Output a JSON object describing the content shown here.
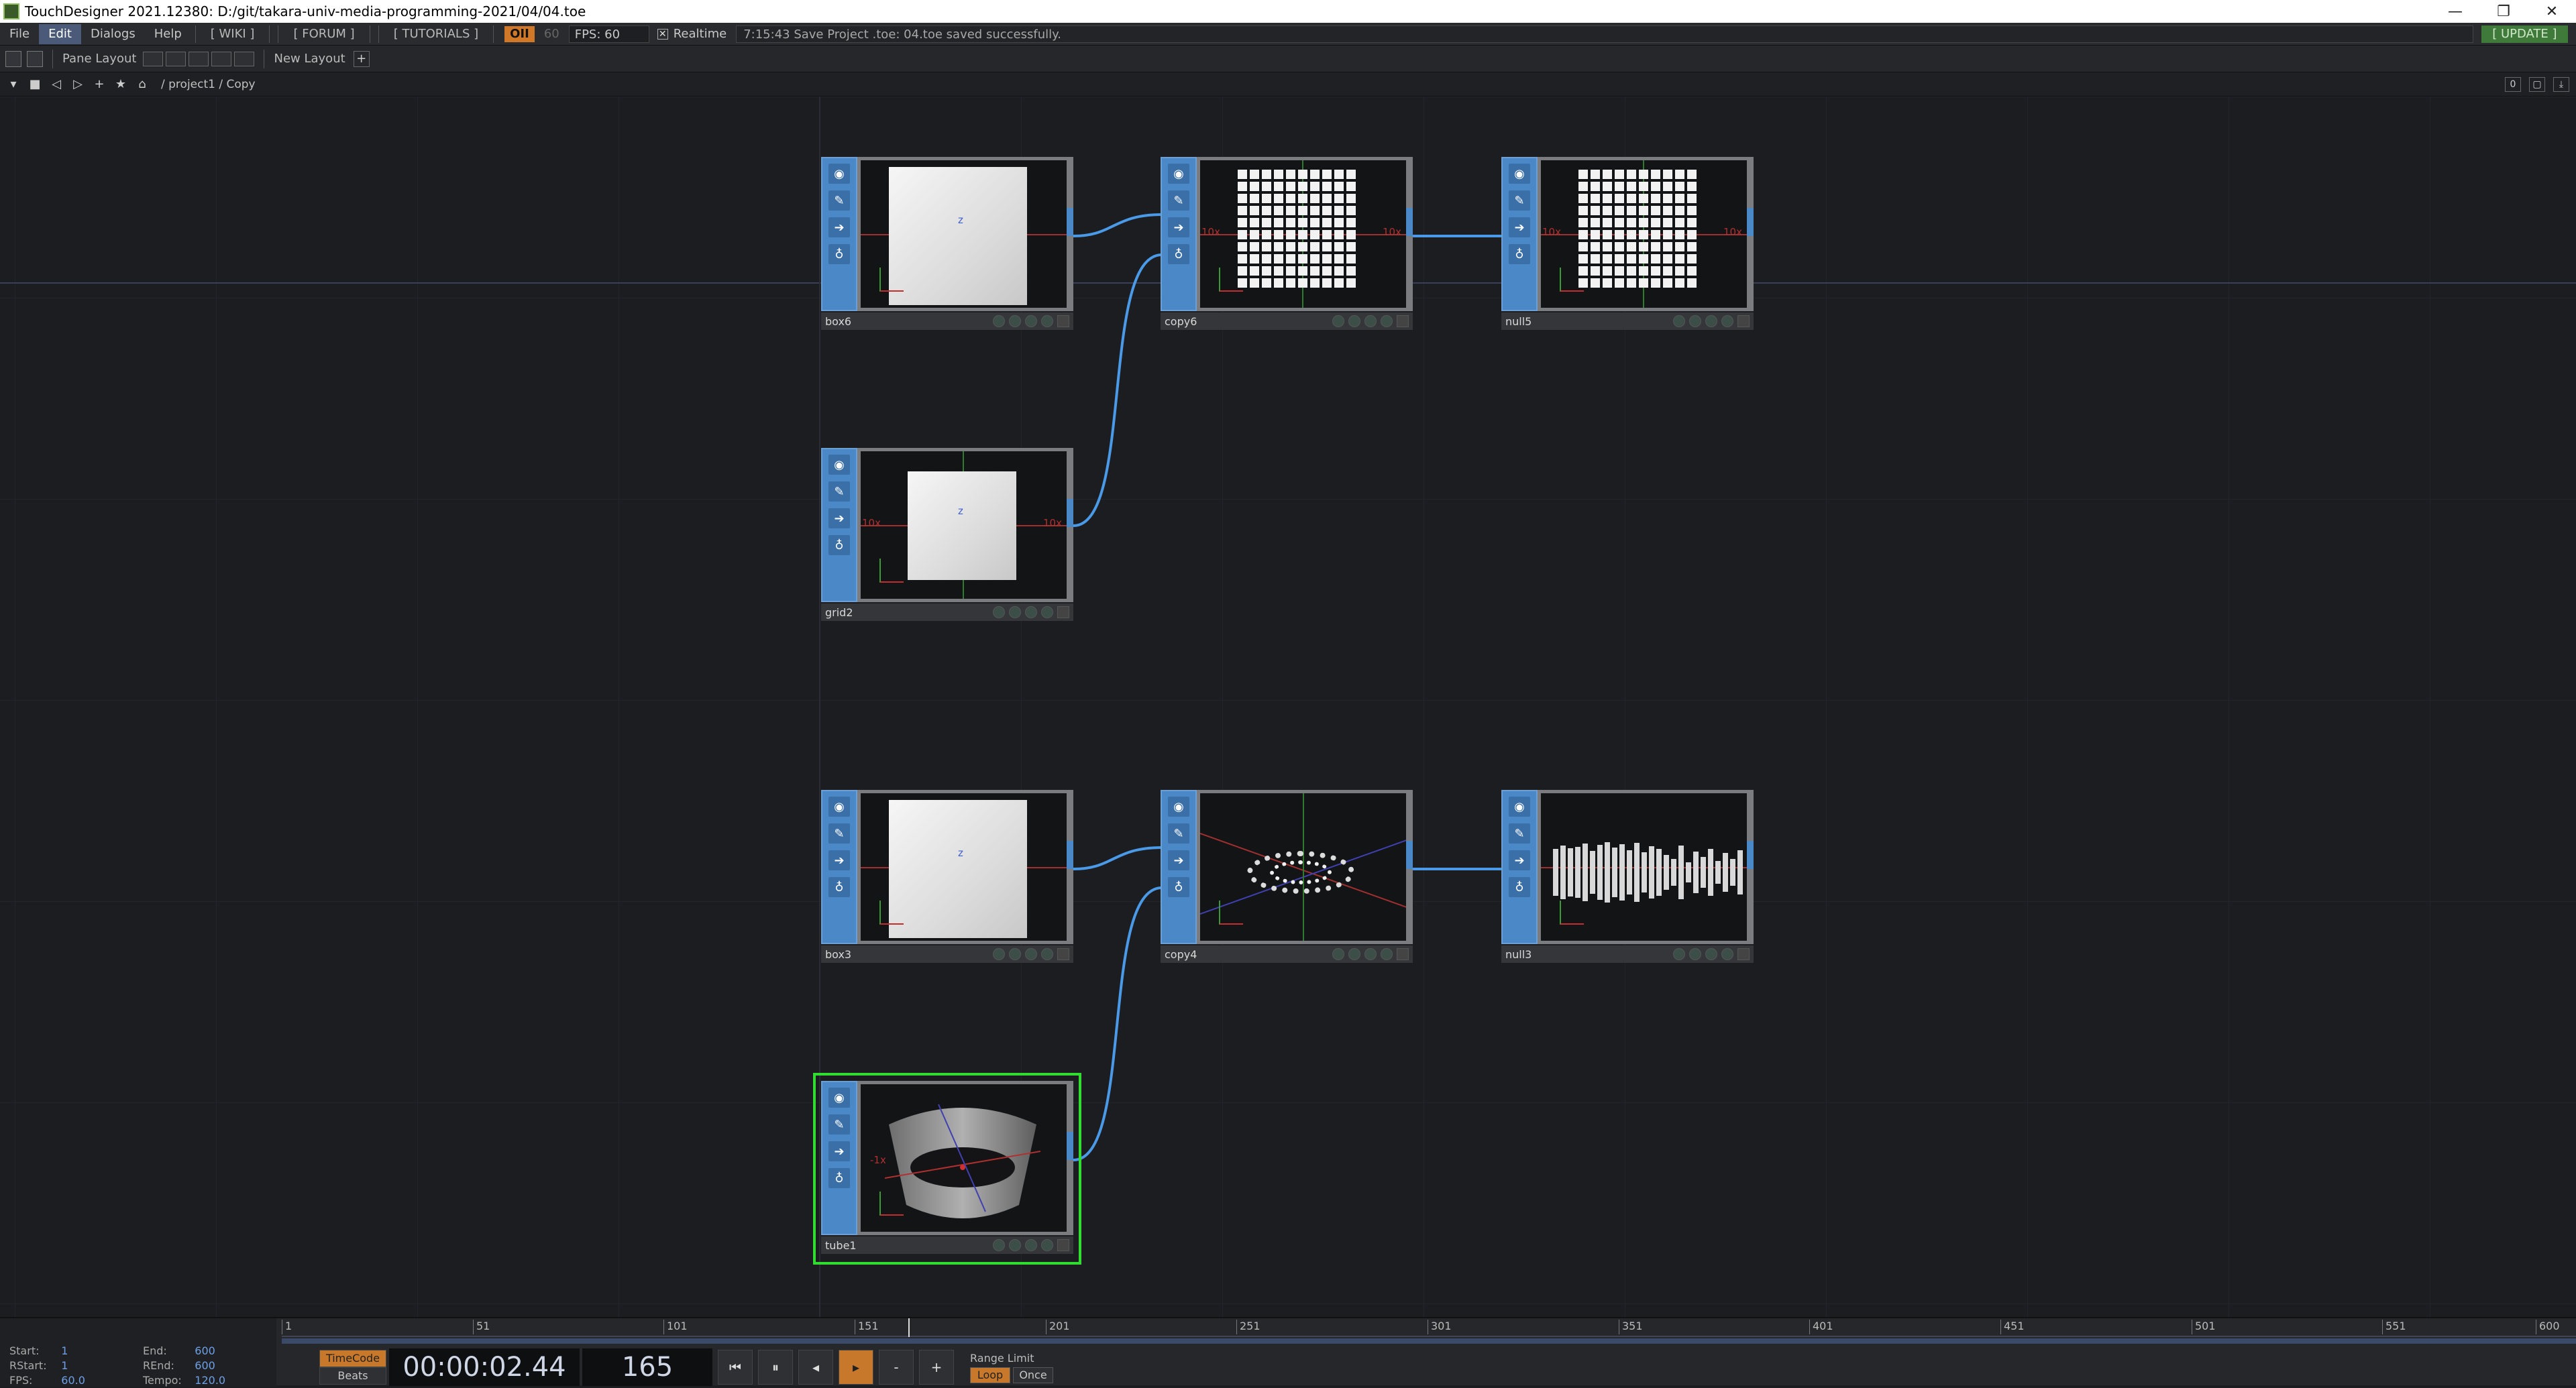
{
  "window": {
    "title": "TouchDesigner 2021.12380: D:/git/takara-univ-media-programming-2021/04/04.toe",
    "buttons": [
      "—",
      "❐",
      "✕"
    ]
  },
  "menubar": {
    "items": [
      "File",
      "Edit",
      "Dialogs",
      "Help"
    ],
    "links": [
      "[ WIKI ]",
      "[ FORUM ]",
      "[ TUTORIALS ]"
    ],
    "oii": "OII",
    "fps_dim": "60",
    "fps_box": "FPS:  60",
    "realtime_label": "Realtime",
    "status_message": "7:15:43 Save Project .toe: 04.toe saved successfully.",
    "update_label": "[ UPDATE ]"
  },
  "panebar": {
    "pane_layout_label": "Pane Layout",
    "new_layout_label": "New Layout"
  },
  "pathbar": {
    "path": "/ project1 / Copy",
    "right_value": "0"
  },
  "nodes": {
    "box6": {
      "name": "box6"
    },
    "copy6": {
      "name": "copy6",
      "tag": "10x"
    },
    "null5": {
      "name": "null5",
      "tag": "10x"
    },
    "grid2": {
      "name": "grid2",
      "tag": "10x"
    },
    "box3": {
      "name": "box3"
    },
    "copy4": {
      "name": "copy4"
    },
    "null3": {
      "name": "null3"
    },
    "tube1": {
      "name": "tube1",
      "tag": "-1x"
    },
    "axis_label": "z"
  },
  "timeline": {
    "info": {
      "start_label": "Start:",
      "start": "1",
      "end_label": "End:",
      "end": "600",
      "rstart_label": "RStart:",
      "rstart": "1",
      "rend_label": "REnd:",
      "rend": "600",
      "fps_label": "FPS:",
      "fps": "60.0",
      "tempo_label": "Tempo:",
      "tempo": "120.0"
    },
    "ticks": [
      "1",
      "51",
      "101",
      "151",
      "201",
      "251",
      "301",
      "351",
      "401",
      "451",
      "501",
      "551",
      "600"
    ],
    "current_frame_fraction": 0.273,
    "timecode_label": "TimeCode",
    "beats_label": "Beats",
    "timecode": "00:00:02.44",
    "frame": "165",
    "range_limit_label": "Range Limit",
    "loop_label": "Loop",
    "once_label": "Once"
  }
}
